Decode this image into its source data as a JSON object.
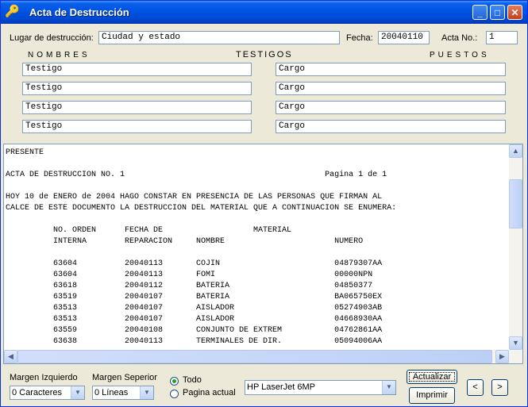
{
  "window": {
    "title": "Acta de Destrucción",
    "icon": "key-icon"
  },
  "header": {
    "lugar_label": "Lugar de destrucción:",
    "lugar_value": "Ciudad y estado",
    "fecha_label": "Fecha:",
    "fecha_value": "20040110",
    "acta_label": "Acta No.:",
    "acta_value": "1"
  },
  "testigos": {
    "nombres_header": "NOMBRES",
    "testigos_header": "TESTIGOS",
    "puestos_header": "PUESTOS",
    "rows": [
      {
        "nombre": "Testigo",
        "puesto": "Cargo"
      },
      {
        "nombre": "Testigo",
        "puesto": "Cargo"
      },
      {
        "nombre": "Testigo",
        "puesto": "Cargo"
      },
      {
        "nombre": "Testigo",
        "puesto": "Cargo"
      }
    ]
  },
  "report": {
    "text": "PRESENTE\n\nACTA DE DESTRUCCION NO. 1                                          Pagina 1 de 1\n\nHOY 10 de ENERO de 2004 HAGO CONSTAR EN PRESENCIA DE LAS PERSONAS QUE FIRMAN AL\nCALCE DE ESTE DOCUMENTO LA DESTRUCCION DEL MATERIAL QUE A CONTINUACION SE ENUMERA:\n\n          NO. ORDEN      FECHA DE                   MATERIAL\n          INTERNA        REPARACION     NOMBRE                       NUMERO\n\n          63604          20040113       COJIN                        04879307AA\n          63604          20040113       FOMI                         00000NPN\n          63618          20040112       BATERIA                      04850377\n          63519          20040107       BATERIA                      BA065750EX\n          63513          20040107       AISLADOR                     05274903AB\n          63513          20040107       AISLADOR                     04668930AA\n          63559          20040108       CONJUNTO DE EXTREM           04762861AA\n          63638          20040113       TERMINALES DE DIR.           05094006AA"
  },
  "footer": {
    "margen_izq_label": "Margen Izquierdo",
    "margen_izq_value": "0 Caracteres",
    "margen_sup_label": "Margen Seperior",
    "margen_sup_value": "0 Líneas",
    "radio_todo": "Todo",
    "radio_pagina": "Pagina actual",
    "printer_value": "HP LaserJet 6MP",
    "actualizar_label": "Actualizar",
    "imprimir_label": "Imprimir",
    "prev_label": "<",
    "next_label": ">"
  }
}
